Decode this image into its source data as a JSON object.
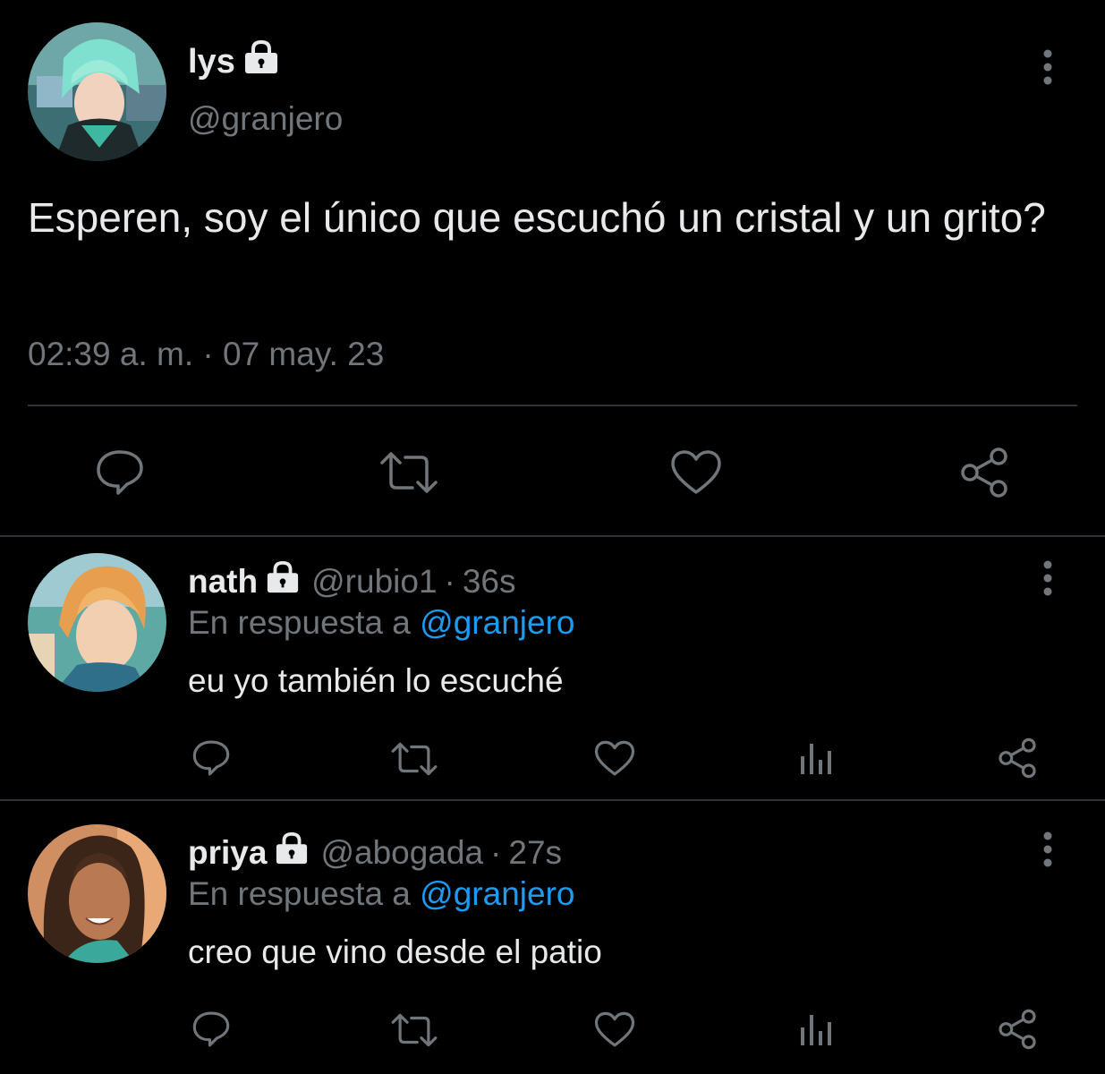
{
  "main_tweet": {
    "author_name": "lys",
    "author_handle": "@granjero",
    "protected_icon": "lock-icon",
    "text": "Esperen, soy el único que escuchó un cristal y un grito?",
    "timestamp": "02:39 a. m. · 07 may. 23",
    "actions": [
      "reply-icon",
      "retweet-icon",
      "like-icon",
      "share-icon"
    ]
  },
  "replies": [
    {
      "author_name": "nath",
      "author_handle": "@rubio1",
      "separator": "·",
      "time": "36s",
      "reply_prefix": "En respuesta a",
      "reply_mention": "@granjero",
      "text": "eu yo también lo escuché",
      "actions": [
        "reply-icon",
        "retweet-icon",
        "like-icon",
        "analytics-icon",
        "share-icon"
      ]
    },
    {
      "author_name": "priya",
      "author_handle": "@abogada",
      "separator": "·",
      "time": "27s",
      "reply_prefix": "En respuesta a",
      "reply_mention": "@granjero",
      "text": "creo que vino desde el patio",
      "actions": [
        "reply-icon",
        "retweet-icon",
        "like-icon",
        "analytics-icon",
        "share-icon"
      ]
    }
  ],
  "colors": {
    "background": "#000000",
    "text_primary": "#e7e9ea",
    "text_secondary": "#71767b",
    "mention": "#1d9bf0",
    "divider": "#2f3336"
  }
}
